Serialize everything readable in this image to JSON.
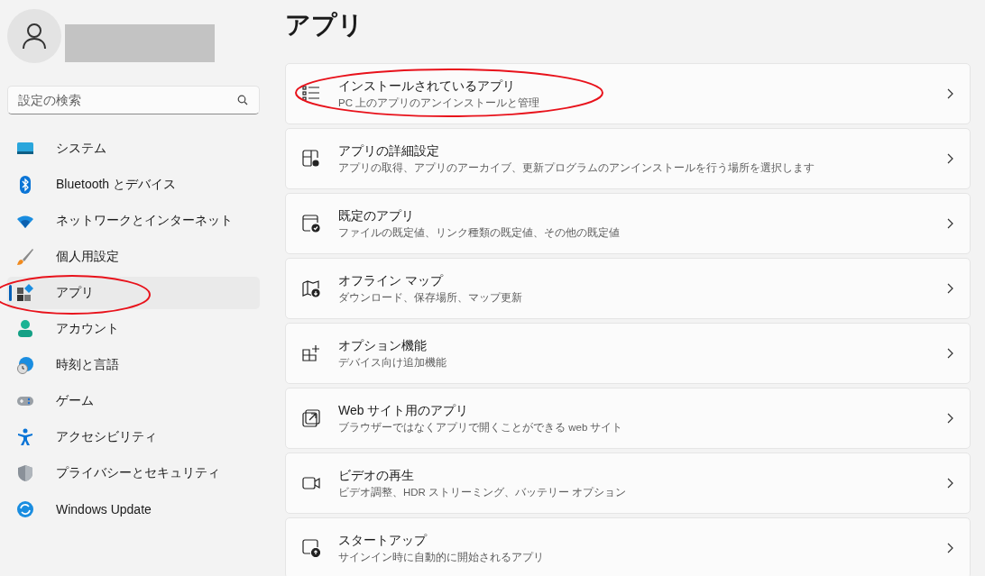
{
  "sidebar": {
    "search": {
      "placeholder": "設定の検索"
    },
    "items": [
      {
        "label": "システム",
        "selected": false
      },
      {
        "label": "Bluetooth とデバイス",
        "selected": false
      },
      {
        "label": "ネットワークとインターネット",
        "selected": false
      },
      {
        "label": "個人用設定",
        "selected": false
      },
      {
        "label": "アプリ",
        "selected": true
      },
      {
        "label": "アカウント",
        "selected": false
      },
      {
        "label": "時刻と言語",
        "selected": false
      },
      {
        "label": "ゲーム",
        "selected": false
      },
      {
        "label": "アクセシビリティ",
        "selected": false
      },
      {
        "label": "プライバシーとセキュリティ",
        "selected": false
      },
      {
        "label": "Windows Update",
        "selected": false
      }
    ]
  },
  "page": {
    "title": "アプリ",
    "cards": [
      {
        "title": "インストールされているアプリ",
        "description": "PC 上のアプリのアンインストールと管理"
      },
      {
        "title": "アプリの詳細設定",
        "description": "アプリの取得、アプリのアーカイブ、更新プログラムのアンインストールを行う場所を選択します"
      },
      {
        "title": "既定のアプリ",
        "description": "ファイルの既定値、リンク種類の既定値、その他の既定値"
      },
      {
        "title": "オフライン マップ",
        "description": "ダウンロード、保存場所、マップ更新"
      },
      {
        "title": "オプション機能",
        "description": "デバイス向け追加機能"
      },
      {
        "title": "Web サイト用のアプリ",
        "description": "ブラウザーではなくアプリで開くことができる web サイト"
      },
      {
        "title": "ビデオの再生",
        "description": "ビデオ調整、HDR ストリーミング、バッテリー オプション"
      },
      {
        "title": "スタートアップ",
        "description": "サインイン時に自動的に開始されるアプリ"
      }
    ]
  }
}
